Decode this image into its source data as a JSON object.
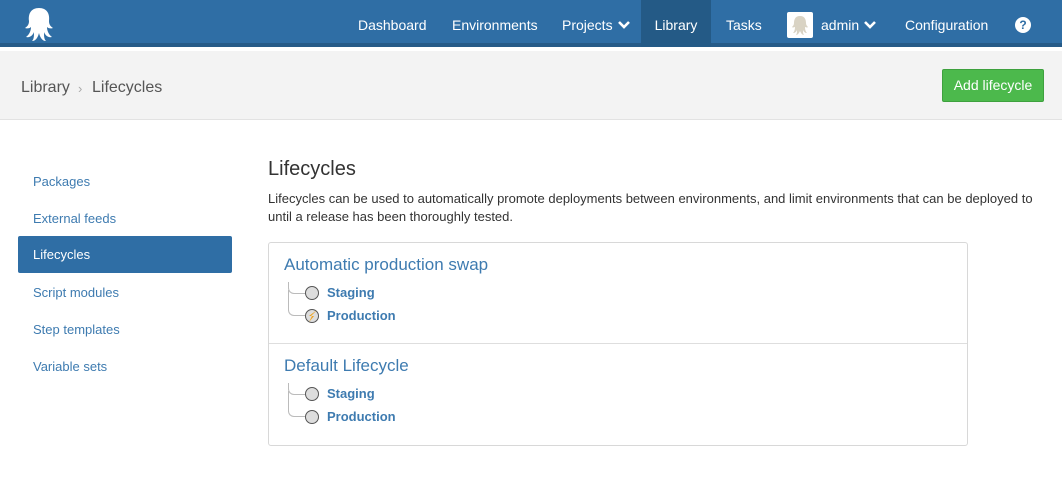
{
  "nav": {
    "dashboard": "Dashboard",
    "environments": "Environments",
    "projects": "Projects",
    "library": "Library",
    "tasks": "Tasks",
    "user": "admin",
    "configuration": "Configuration"
  },
  "breadcrumb": {
    "parent": "Library",
    "current": "Lifecycles"
  },
  "add_button": "Add lifecycle",
  "sidebar": {
    "items": [
      {
        "label": "Packages"
      },
      {
        "label": "External feeds"
      },
      {
        "label": "Lifecycles"
      },
      {
        "label": "Script modules"
      },
      {
        "label": "Step templates"
      },
      {
        "label": "Variable sets"
      }
    ]
  },
  "main": {
    "title": "Lifecycles",
    "description": "Lifecycles can be used to automatically promote deployments between environments, and limit environments that can be deployed to until a release has been thoroughly tested."
  },
  "lifecycles": [
    {
      "name": "Automatic production swap",
      "phases": [
        {
          "name": "Staging",
          "icon": "phase-circle-icon"
        },
        {
          "name": "Production",
          "icon": "auto-deploy-phase-icon"
        }
      ]
    },
    {
      "name": "Default Lifecycle",
      "phases": [
        {
          "name": "Staging",
          "icon": "phase-circle-icon"
        },
        {
          "name": "Production",
          "icon": "phase-circle-icon"
        }
      ]
    }
  ],
  "colors": {
    "nav_bg": "#2f6ea5",
    "accent": "#3e7bb0",
    "button_green": "#4cb94c"
  }
}
